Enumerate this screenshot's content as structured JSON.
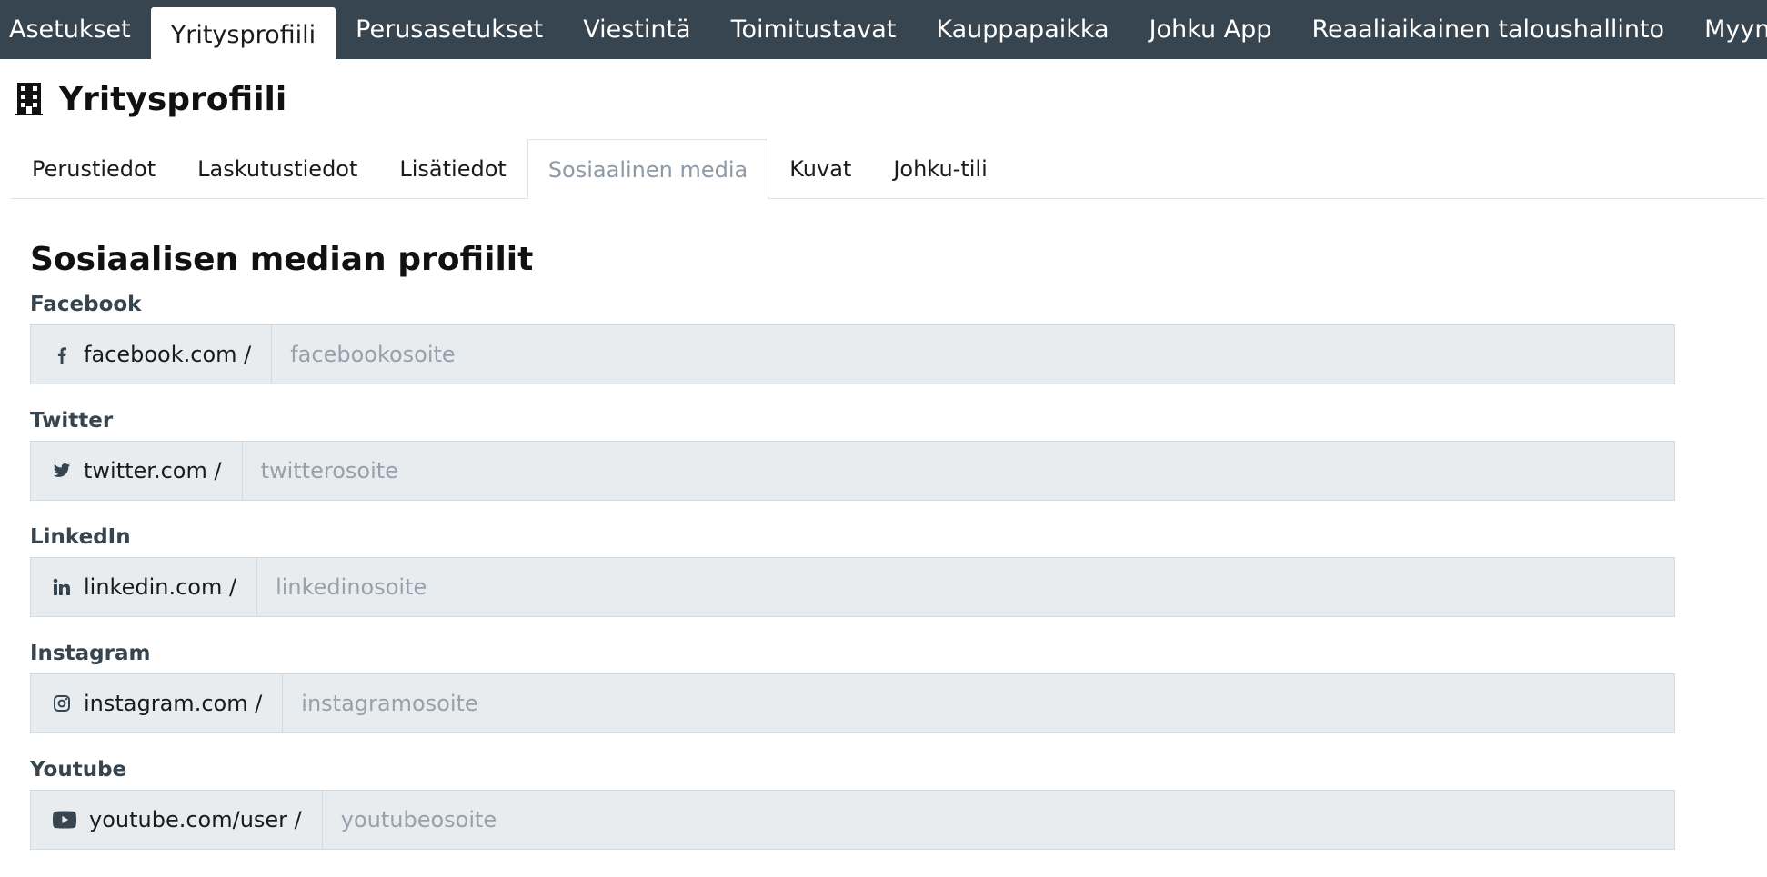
{
  "topnav": {
    "items": [
      "Asetukset",
      "Yritysprofiili",
      "Perusasetukset",
      "Viestintä",
      "Toimitustavat",
      "Kauppapaikka",
      "Johku App",
      "Reaaliaikainen taloushallinto",
      "Myyntikanava-ase"
    ],
    "active": "Yritysprofiili"
  },
  "page": {
    "title": "Yritysprofiili",
    "icon": "building-icon"
  },
  "tabs": {
    "items": [
      "Perustiedot",
      "Laskutustiedot",
      "Lisätiedot",
      "Sosiaalinen media",
      "Kuvat",
      "Johku-tili"
    ],
    "active": "Sosiaalinen media"
  },
  "section": {
    "title": "Sosiaalisen median profiilit"
  },
  "fields": [
    {
      "label": "Facebook",
      "icon": "facebook-icon",
      "prefix": "facebook.com /",
      "placeholder": "facebookosoite",
      "value": ""
    },
    {
      "label": "Twitter",
      "icon": "twitter-icon",
      "prefix": "twitter.com /",
      "placeholder": "twitterosoite",
      "value": ""
    },
    {
      "label": "LinkedIn",
      "icon": "linkedin-icon",
      "prefix": "linkedin.com /",
      "placeholder": "linkedinosoite",
      "value": ""
    },
    {
      "label": "Instagram",
      "icon": "instagram-icon",
      "prefix": "instagram.com /",
      "placeholder": "instagramosoite",
      "value": ""
    },
    {
      "label": "Youtube",
      "icon": "youtube-icon",
      "prefix": "youtube.com/user /",
      "placeholder": "youtubeosoite",
      "value": ""
    }
  ],
  "colors": {
    "navbar": "#36454f",
    "input_bg": "#e9ecef",
    "border": "#d3d9df",
    "active_tab_text": "#8e99a6"
  }
}
